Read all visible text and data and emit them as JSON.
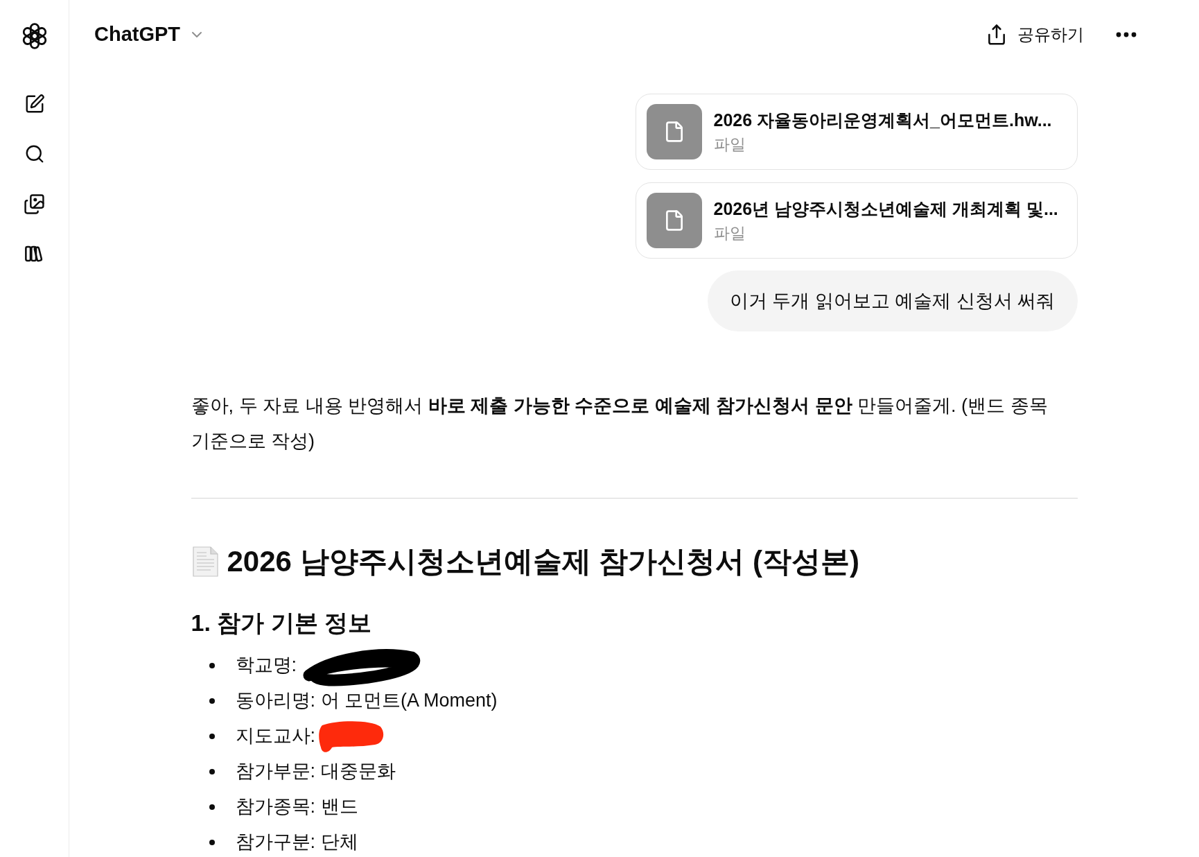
{
  "header": {
    "title": "ChatGPT",
    "share_label": "공유하기"
  },
  "attachments": [
    {
      "name": "2026 자율동아리운영계획서_어모먼트.hw...",
      "type_label": "파일"
    },
    {
      "name": "2026년 남양주시청소년예술제 개최계획 및...",
      "type_label": "파일"
    }
  ],
  "user_message": "이거 두개 읽어보고 예술제 신청서 써줘",
  "assistant": {
    "intro": "좋아, 두 자료 내용 반영해서 **바로 제출 가능한 수준으로 예술제 참가신청서 문안** 만들어줄게. (밴드 종목 기준으로 작성)",
    "title": "2026 남양주시청소년예술제 참가신청서 (작성본)",
    "sections": [
      {
        "heading": "1. 참가 기본 정보",
        "items": [
          {
            "kind": "redacted",
            "label": "학교명:",
            "color": "#000000"
          },
          {
            "kind": "text",
            "text": "동아리명: 어 모먼트(A Moment)"
          },
          {
            "kind": "redacted",
            "label": "지도교사:",
            "color": "#fe2a0c"
          },
          {
            "kind": "text",
            "text": "참가부문: 대중문화"
          },
          {
            "kind": "text",
            "text": "참가종목: 밴드"
          },
          {
            "kind": "text",
            "text": "참가구분: 단체"
          }
        ]
      }
    ]
  }
}
